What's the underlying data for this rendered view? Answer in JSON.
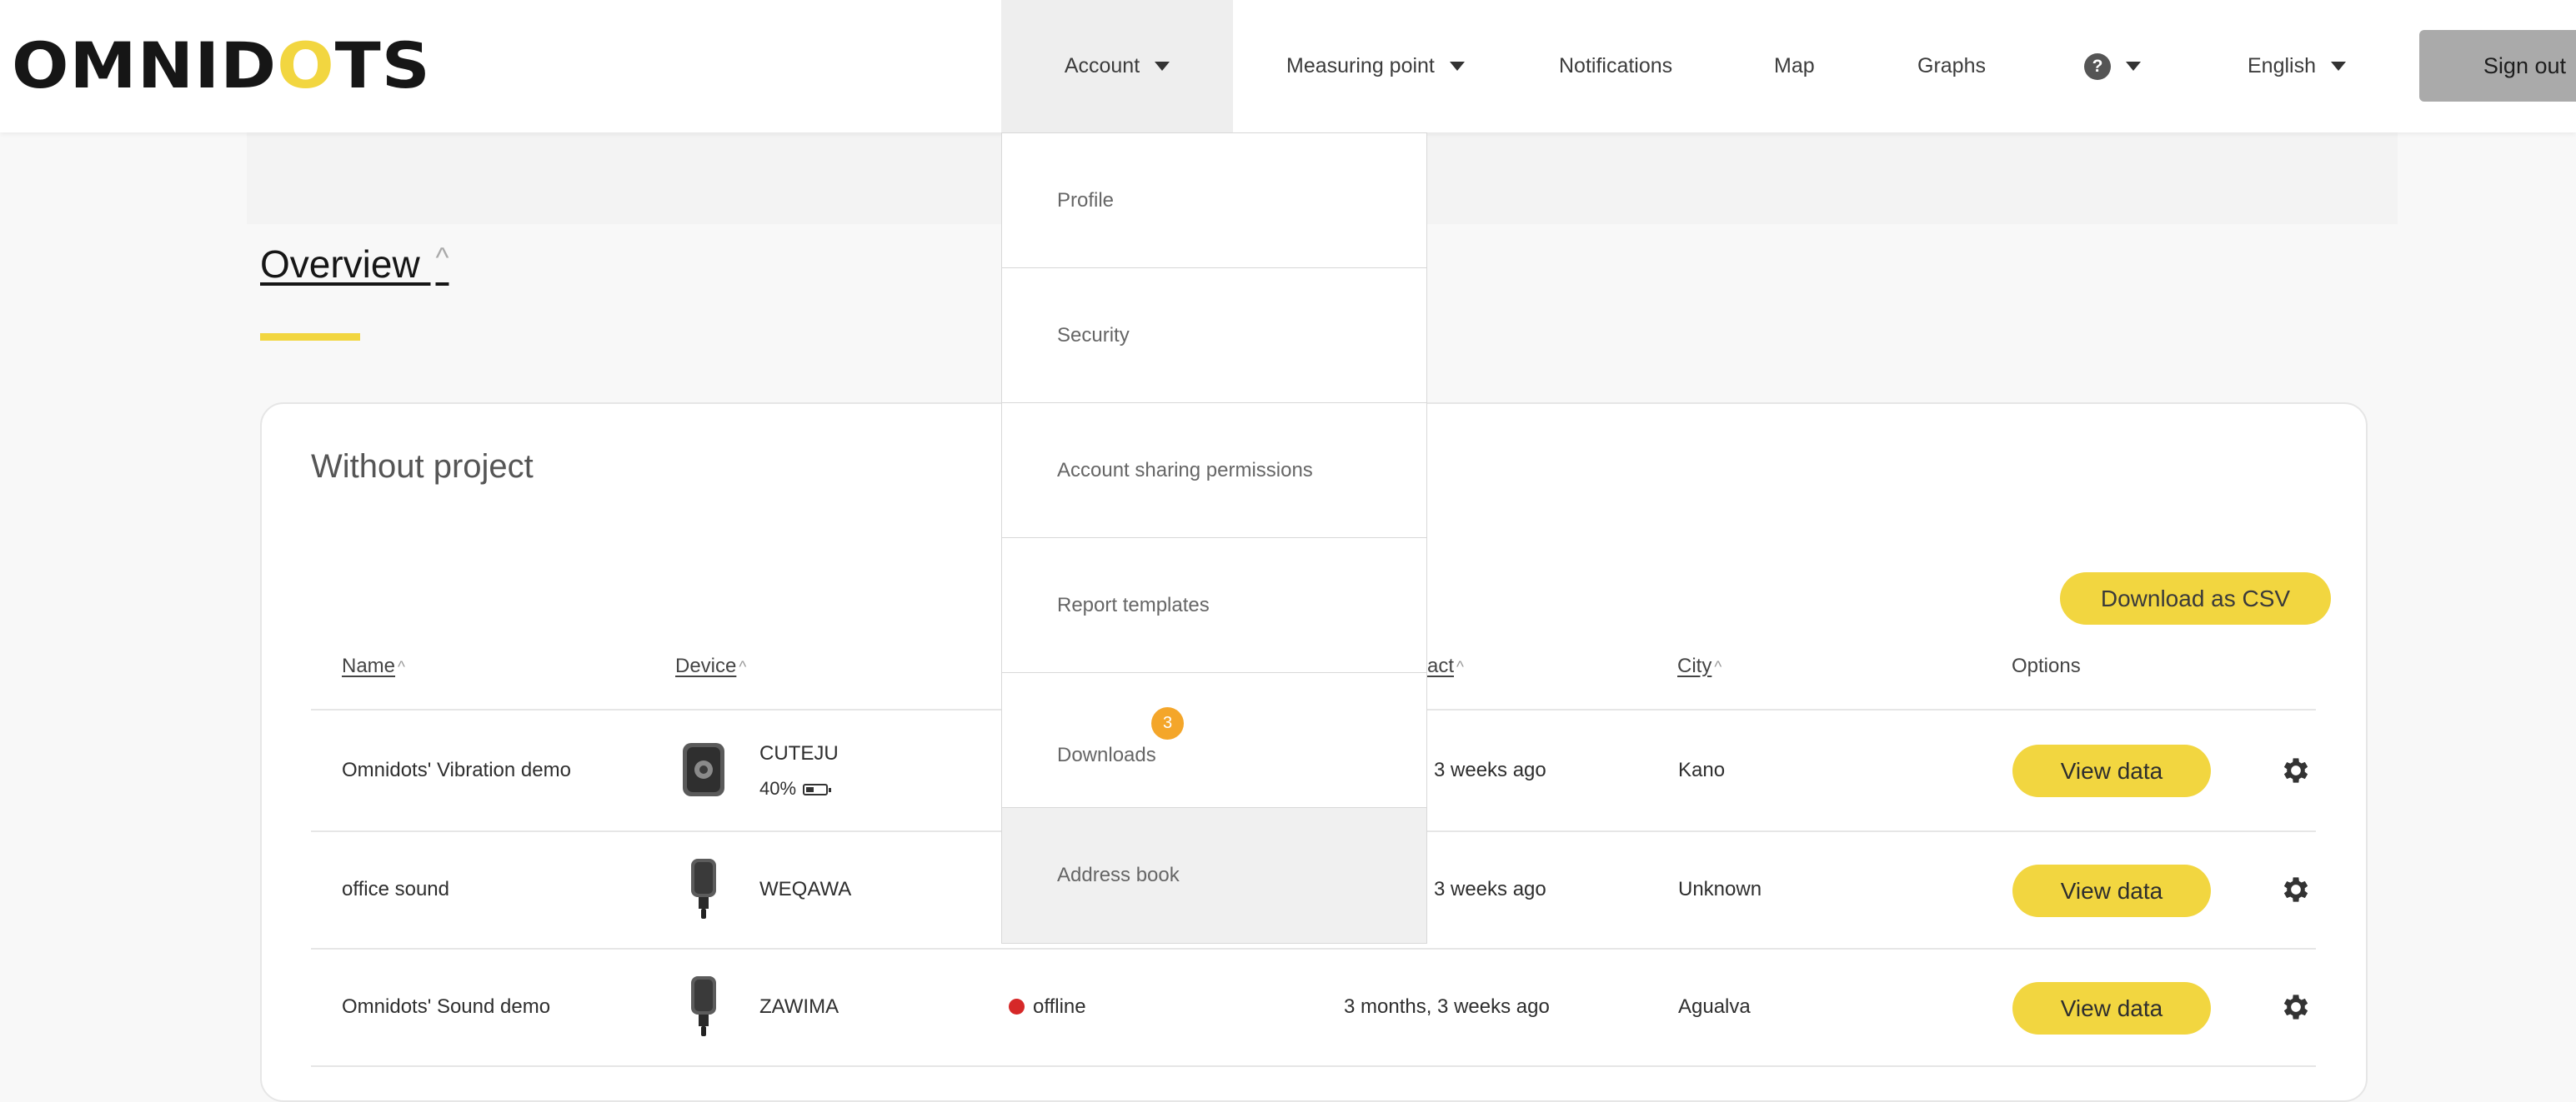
{
  "brand": {
    "logo_pre": "OMNID",
    "logo_o": "O",
    "logo_post": "TS"
  },
  "nav": {
    "account": "Account",
    "measuring_point": "Measuring point",
    "notifications": "Notifications",
    "map": "Map",
    "graphs": "Graphs",
    "help": "?",
    "language": "English",
    "signout": "Sign out"
  },
  "account_menu": {
    "items": [
      "Profile",
      "Security",
      "Account sharing permissions",
      "Report templates",
      "Downloads",
      "Address book"
    ],
    "downloads_badge": "3"
  },
  "overview": {
    "title": "Overview ",
    "sort": "^"
  },
  "card": {
    "title": "Without project",
    "csv_button": "Download as CSV",
    "columns": {
      "name": "Name",
      "device": "Device",
      "contact_partial": "act",
      "city": "City",
      "options": "Options",
      "sort": "^"
    },
    "rows": [
      {
        "name": "Omnidots' Vibration demo",
        "device": "CUTEJU",
        "battery": "40%",
        "status": "",
        "last": "3 weeks ago",
        "city": "Kano",
        "action": "View data"
      },
      {
        "name": "office sound",
        "device": "WEQAWA",
        "battery": "",
        "status": "",
        "last": "3 weeks ago",
        "city": "Unknown",
        "action": "View data"
      },
      {
        "name": "Omnidots' Sound demo",
        "device": "ZAWIMA",
        "battery": "",
        "status": "offline",
        "last": "3 months, 3 weeks ago",
        "city": "Agualva",
        "action": "View data"
      }
    ]
  },
  "colors": {
    "accent": "#f2d640",
    "badge": "#f4a62a",
    "offline": "#d62828"
  }
}
